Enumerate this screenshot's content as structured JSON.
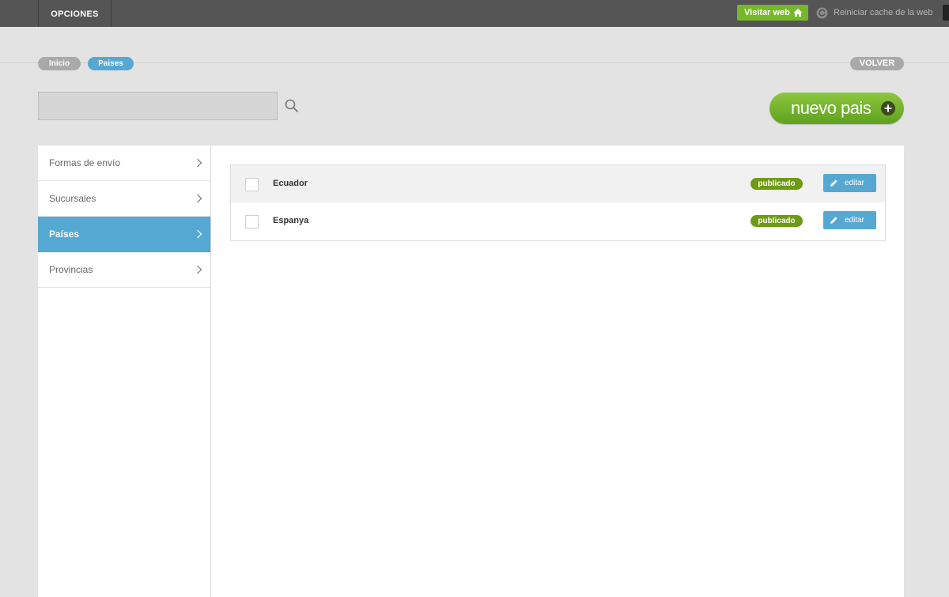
{
  "topbar": {
    "menu_label": "OPCIONES",
    "visit_label": "Visitar web",
    "cache_label": "Reiniciar cache de la web"
  },
  "breadcrumb": {
    "items": [
      "Inicio",
      "Paises"
    ],
    "back_label": "VOLVER"
  },
  "search": {
    "value": "",
    "placeholder": ""
  },
  "actions": {
    "new_label": "nuevo pais"
  },
  "sidebar": {
    "items": [
      {
        "label": "Formas de envío"
      },
      {
        "label": "Sucursales"
      },
      {
        "label": "Países"
      },
      {
        "label": "Provincias"
      }
    ],
    "active_index": 2
  },
  "rows": [
    {
      "name": "Ecuador",
      "status": "publicado",
      "edit_label": "editar"
    },
    {
      "name": "Espanya",
      "status": "publicado",
      "edit_label": "editar"
    }
  ],
  "colors": {
    "accent_blue": "#55a8d1",
    "accent_green": "#76b82a",
    "badge_green": "#6e9a14",
    "topbar": "#555555"
  },
  "icons": [
    "home-icon",
    "refresh-icon",
    "search-icon",
    "plus-icon",
    "chevron-right-icon",
    "pencil-icon"
  ]
}
